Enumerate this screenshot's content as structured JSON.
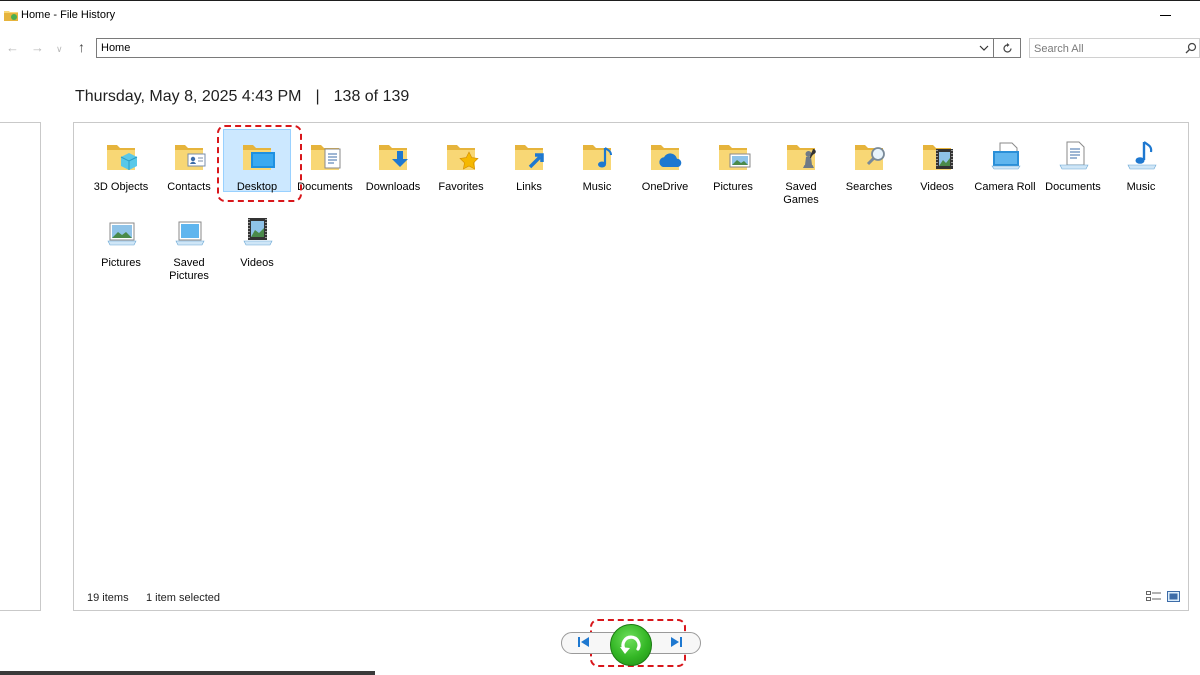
{
  "window": {
    "title": "Home - File History"
  },
  "address_bar": {
    "path": "Home"
  },
  "search": {
    "placeholder": "Search All"
  },
  "snapshot": {
    "datetime": "Thursday, May 8, 2025 4:43 PM",
    "separator": "|",
    "position": "138 of 139"
  },
  "items": [
    {
      "label": "3D Objects",
      "icon": "3d-objects-folder-icon"
    },
    {
      "label": "Contacts",
      "icon": "contacts-folder-icon"
    },
    {
      "label": "Desktop",
      "icon": "desktop-folder-icon",
      "selected": true
    },
    {
      "label": "Documents",
      "icon": "documents-folder-icon"
    },
    {
      "label": "Downloads",
      "icon": "downloads-folder-icon"
    },
    {
      "label": "Favorites",
      "icon": "favorites-folder-icon"
    },
    {
      "label": "Links",
      "icon": "links-folder-icon"
    },
    {
      "label": "Music",
      "icon": "music-folder-icon"
    },
    {
      "label": "OneDrive",
      "icon": "onedrive-folder-icon"
    },
    {
      "label": "Pictures",
      "icon": "pictures-folder-icon"
    },
    {
      "label": "Saved Games",
      "icon": "saved-games-folder-icon"
    },
    {
      "label": "Searches",
      "icon": "searches-folder-icon"
    },
    {
      "label": "Videos",
      "icon": "videos-folder-icon"
    },
    {
      "label": "Camera Roll",
      "icon": "camera-roll-library-icon"
    },
    {
      "label": "Documents",
      "icon": "documents-library-icon"
    },
    {
      "label": "Music",
      "icon": "music-library-icon"
    },
    {
      "label": "Pictures",
      "icon": "pictures-library-icon"
    },
    {
      "label": "Saved Pictures",
      "icon": "saved-pictures-library-icon"
    },
    {
      "label": "Videos",
      "icon": "videos-library-icon"
    }
  ],
  "status": {
    "count": "19 items",
    "selection": "1 item selected"
  },
  "colors": {
    "folder": "#f8d775",
    "folder_dark": "#e6b43c",
    "accent_blue": "#1e90e0",
    "highlight_red": "#d8161b",
    "restore_green": "#33b625",
    "selection_bg": "#cce8ff"
  }
}
